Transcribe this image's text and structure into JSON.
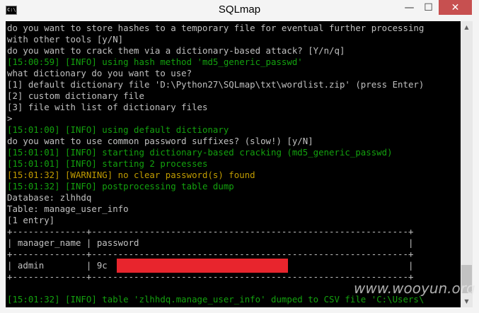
{
  "window": {
    "title": "SQLmap",
    "icon_text": "C:\\",
    "buttons": {
      "minimize": "—",
      "maximize": "☐",
      "close": "✕"
    }
  },
  "console": {
    "lines": [
      {
        "text": "do you want to store hashes to a temporary file for eventual further processing",
        "color": "default"
      },
      {
        "text": "with other tools [y/N]",
        "color": "default"
      },
      {
        "text": "do you want to crack them via a dictionary-based attack? [Y/n/q]",
        "color": "default"
      },
      {
        "text": "[15:00:59] [INFO] using hash method 'md5_generic_passwd'",
        "color": "green"
      },
      {
        "text": "what dictionary do you want to use?",
        "color": "default"
      },
      {
        "text": "[1] default dictionary file 'D:\\Python27\\SQLmap\\txt\\wordlist.zip' (press Enter)",
        "color": "default"
      },
      {
        "text": "[2] custom dictionary file",
        "color": "default"
      },
      {
        "text": "[3] file with list of dictionary files",
        "color": "default"
      },
      {
        "text": ">",
        "color": "default"
      },
      {
        "text": "[15:01:00] [INFO] using default dictionary",
        "color": "green"
      },
      {
        "text": "do you want to use common password suffixes? (slow!) [y/N]",
        "color": "default"
      },
      {
        "text": "[15:01:01] [INFO] starting dictionary-based cracking (md5_generic_passwd)",
        "color": "green"
      },
      {
        "text": "[15:01:01] [INFO] starting 2 processes",
        "color": "green"
      },
      {
        "text": "[15:01:32] [WARNING] no clear password(s) found",
        "color": "yellow"
      },
      {
        "text": "[15:01:32] [INFO] postprocessing table dump",
        "color": "green"
      },
      {
        "text": "Database: zlhhdq",
        "color": "default"
      },
      {
        "text": "Table: manage_user_info",
        "color": "default"
      },
      {
        "text": "[1 entry]",
        "color": "default"
      },
      {
        "text": "+--------------+------------------------------------------------------------+",
        "color": "default"
      },
      {
        "text": "| manager_name | password                                                   |",
        "color": "default"
      },
      {
        "text": "+--------------+------------------------------------------------------------+",
        "color": "default"
      },
      {
        "text": "| admin        | 9c                                                         |",
        "color": "default"
      },
      {
        "text": "+--------------+------------------------------------------------------------+",
        "color": "default"
      },
      {
        "text": "",
        "color": "default"
      },
      {
        "text": "[15:01:32] [INFO] table 'zlhhdq.manage_user_info' dumped to CSV file 'C:\\Users\\",
        "color": "green"
      }
    ]
  },
  "watermark": "www.wooyun.org",
  "colors": {
    "console_bg": "#000000",
    "default_text": "#c0c0c0",
    "info_green": "#13a10e",
    "warning_yellow": "#c19c00",
    "redaction": "#e8252d",
    "close_button": "#c75050"
  }
}
